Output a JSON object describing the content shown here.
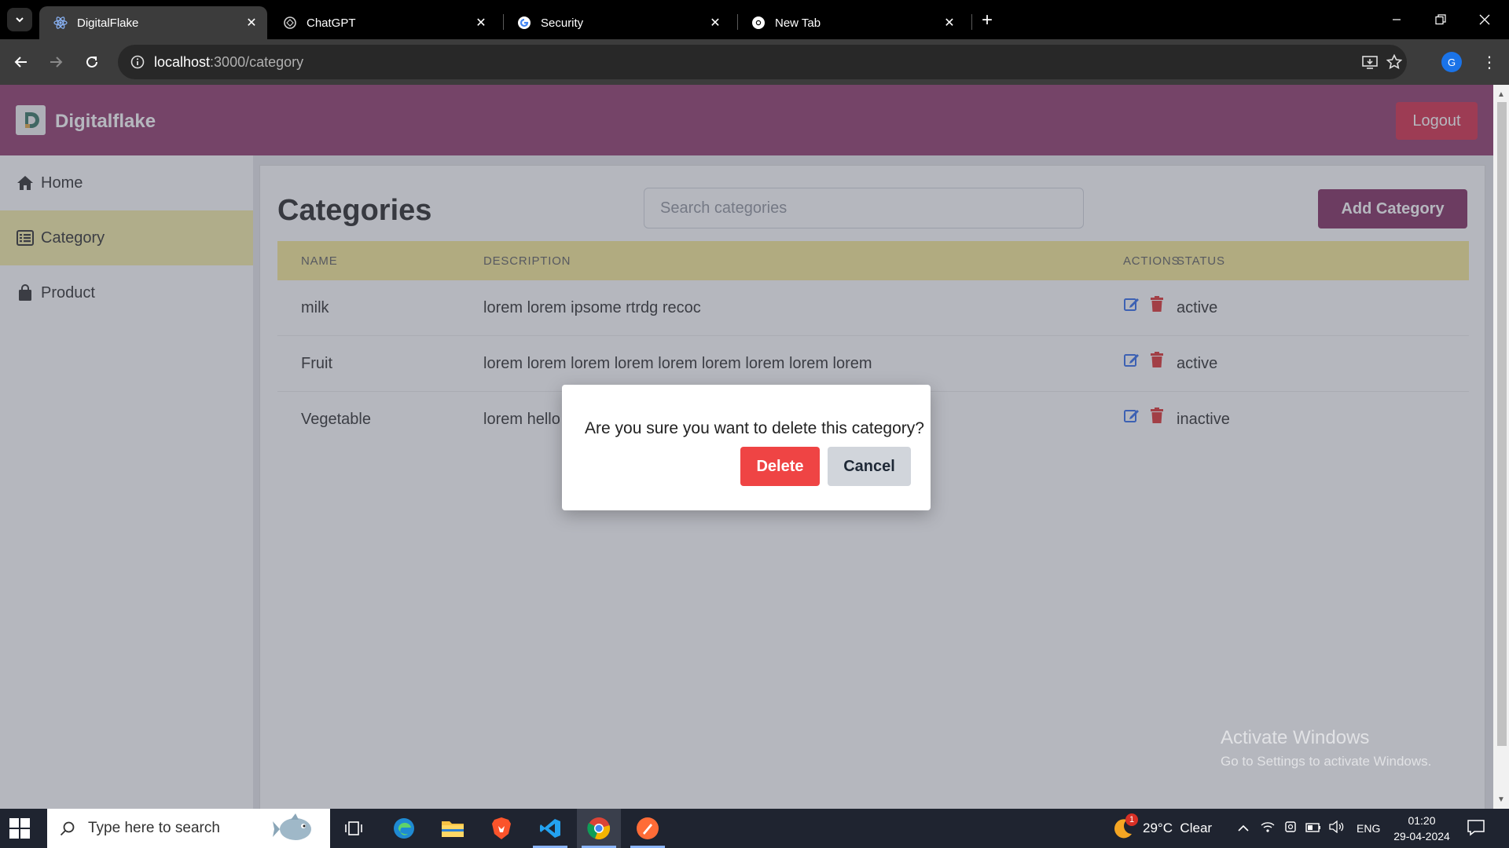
{
  "browser": {
    "tabs": [
      {
        "title": "DigitalFlake",
        "icon": "react-icon",
        "active": true
      },
      {
        "title": "ChatGPT",
        "icon": "chatgpt-icon",
        "active": false
      },
      {
        "title": "Security",
        "icon": "google-icon",
        "active": false
      },
      {
        "title": "New Tab",
        "icon": "chrome-icon",
        "active": false
      }
    ],
    "url_host": "localhost",
    "url_path": ":3000/category",
    "profile_initial": "G"
  },
  "app": {
    "brand": "Digitalflake",
    "logout_label": "Logout",
    "sidebar": {
      "items": [
        {
          "label": "Home",
          "icon": "home-icon"
        },
        {
          "label": "Category",
          "icon": "list-icon",
          "active": true
        },
        {
          "label": "Product",
          "icon": "bag-icon"
        }
      ]
    },
    "page_title": "Categories",
    "search_placeholder": "Search categories",
    "add_label": "Add Category",
    "table": {
      "headers": {
        "name": "NAME",
        "description": "DESCRIPTION",
        "status": "STATUS",
        "actions": "ACTIONS"
      },
      "rows": [
        {
          "name": "milk",
          "description": "lorem lorem ipsome rtrdg recoc",
          "status": "active"
        },
        {
          "name": "Fruit",
          "description": "lorem lorem lorem lorem lorem lorem lorem lorem lorem",
          "status": "active"
        },
        {
          "name": "Vegetable",
          "description": "lorem hello",
          "status": "inactive"
        }
      ]
    },
    "modal": {
      "message": "Are you sure you want to delete this category?",
      "delete_label": "Delete",
      "cancel_label": "Cancel"
    }
  },
  "watermark": {
    "line1": "Activate Windows",
    "line2": "Go to Settings to activate Windows."
  },
  "taskbar": {
    "search_placeholder": "Type here to search",
    "weather": "29°C  Clear",
    "weather_badge": "1",
    "language": "ENG",
    "time": "01:20",
    "date": "29-04-2024"
  },
  "colors": {
    "header": "#8b2f63",
    "active_sidebar": "#f6eda0",
    "table_header": "#f7e98f",
    "add_button": "#7b1f56",
    "logout_button": "#d4203f",
    "delete_button": "#ef4444",
    "cancel_button": "#d1d5db",
    "edit_icon": "#2563eb",
    "trash_icon": "#dc2626"
  }
}
